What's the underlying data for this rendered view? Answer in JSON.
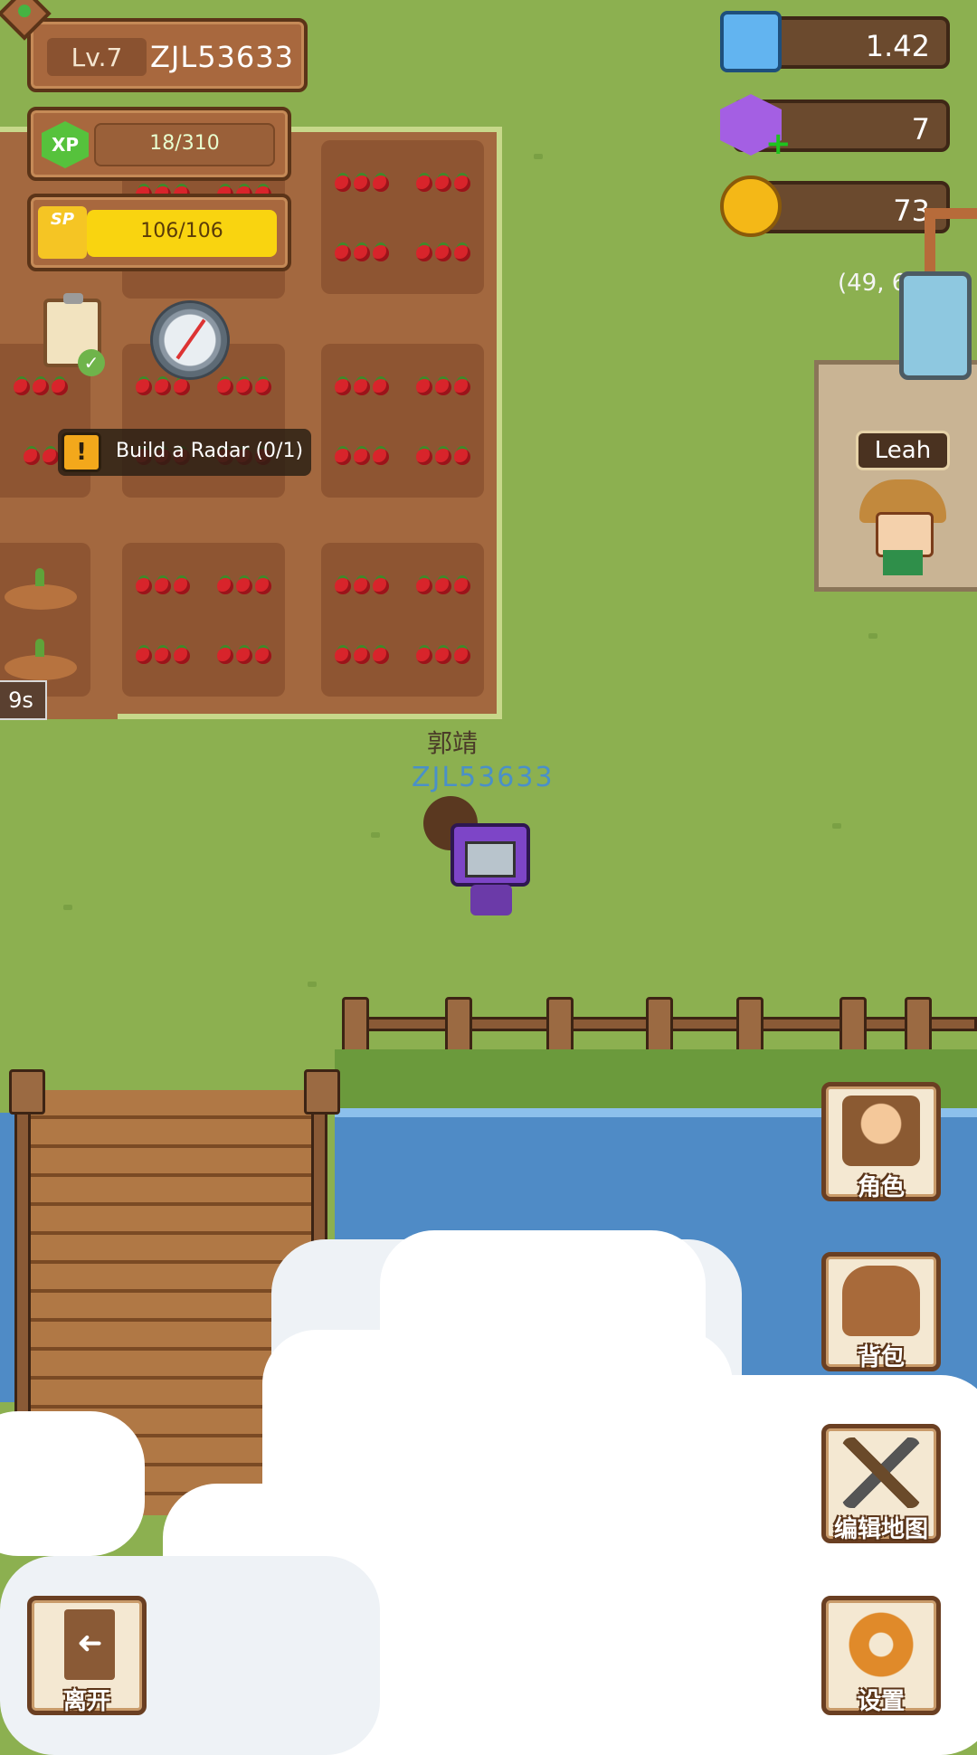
{
  "player": {
    "level": "Lv.7",
    "username": "ZJL53633",
    "display_name": "郭靖",
    "tag": "ZJL53633"
  },
  "xp": {
    "text": "18/310",
    "current": 18,
    "max": 310
  },
  "sp": {
    "text": "106/106",
    "current": 106,
    "max": 106,
    "fill_fraction": 1.0
  },
  "currencies": {
    "crystal": "1.42",
    "gems": "7",
    "coins": "73"
  },
  "quest": {
    "alert_symbol": "!",
    "text": "Build a Radar (0/1)"
  },
  "map": {
    "coordinates": "(49, 67)",
    "timer": "9s"
  },
  "npc": {
    "name": "Leah"
  },
  "menu": {
    "character_label": "角色",
    "backpack_label": "背包",
    "edit_map_label": "编辑地图",
    "settings_label": "设置",
    "exit_label": "离开"
  },
  "badges": {
    "xp": "XP",
    "sp": "SP"
  },
  "icons": {
    "wifi": "wifi-icon",
    "crystal": "crystal-icon",
    "gem": "gem-icon",
    "coin": "coin-icon",
    "quest": "clipboard-icon",
    "radar": "compass-icon"
  },
  "colors": {
    "grass": "#8cb050",
    "soil": "#a3683f",
    "water": "#4f8bc6",
    "sp_fill": "#f9d410",
    "xp_green": "#56c23c",
    "player_tag": "#4a90c8"
  }
}
